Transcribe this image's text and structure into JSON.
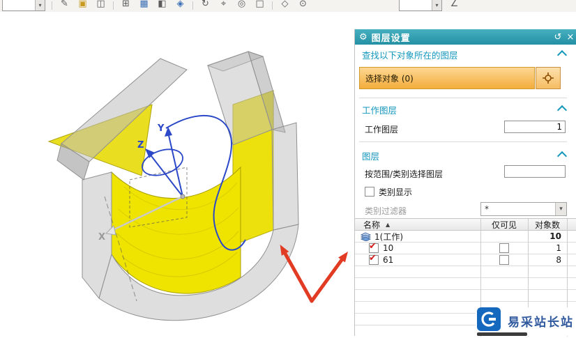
{
  "toolbar": {
    "left_combo_value": "",
    "right_combo_value": "",
    "icons": [
      "✎",
      "▣",
      "◫",
      "⊞",
      "▦",
      "◧",
      "◈",
      "↻",
      "⌖",
      "◎",
      "□",
      "◇",
      "⊙",
      "∠"
    ]
  },
  "panel": {
    "title": "图层设置",
    "find_section": {
      "title": "查找以下对象所在的图层",
      "select_object_label": "选择对象 (0)"
    },
    "work_layer_section": {
      "title": "工作图层",
      "field_label": "工作图层",
      "field_value": "1"
    },
    "layers_section": {
      "title": "图层",
      "range_label": "按范围/类别选择图层",
      "range_value": "",
      "category_display_label": "类别显示",
      "category_filter_label": "类别过滤器",
      "category_filter_value": "*",
      "table": {
        "col_name": "名称",
        "col_visible_only": "仅可见",
        "col_object_count": "对象数",
        "rows": [
          {
            "name": "1(工作)",
            "count": "10",
            "checked": null,
            "visible_only_checked": null,
            "bold_count": true
          },
          {
            "name": "10",
            "count": "1",
            "checked": true,
            "visible_only_checked": false
          },
          {
            "name": "61",
            "count": "8",
            "checked": true,
            "visible_only_checked": false
          }
        ]
      }
    }
  },
  "viewport": {
    "axis_x": "X",
    "axis_y": "Y",
    "axis_z": "Z"
  },
  "watermark": {
    "title": "易采站长站"
  },
  "colors": {
    "header_teal": "#2E9FB0",
    "section_cyan": "#1598BD",
    "select_orange": "#F7BE62",
    "check_red": "#D41A1A",
    "arrow_red": "#E23B24",
    "model_yellow": "#EFE400"
  }
}
